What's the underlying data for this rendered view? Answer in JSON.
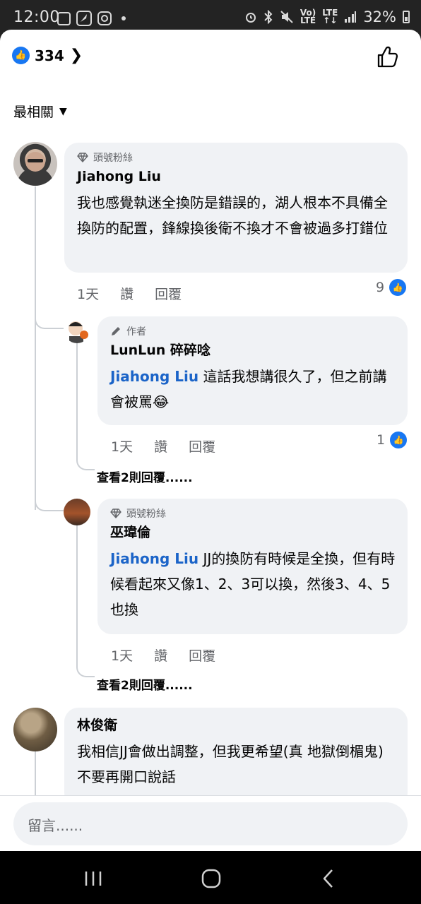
{
  "status_bar": {
    "time": "12:00",
    "battery": "32%",
    "lte_top": "Vo)\nLTE",
    "lte_bottom": "LTE\n↑↓"
  },
  "header": {
    "like_count": "334"
  },
  "sort": {
    "label": "最相關"
  },
  "comments": [
    {
      "badge": "頭號粉絲",
      "author": "Jiahong Liu",
      "text": "我也感覺執迷全換防是錯誤的，湖人根本不具備全換防的配置，鋒線換後衛不換才不會被過多打錯位",
      "time": "1天",
      "like": "讚",
      "reply": "回覆",
      "reactions": "9",
      "replies": [
        {
          "badge": "作者",
          "author": "LunLun 碎碎唸",
          "mention": "Jiahong Liu",
          "text": " 這話我想講很久了，但之前講會被罵",
          "emoji": "😂",
          "time": "1天",
          "like": "讚",
          "reply": "回覆",
          "reactions": "1",
          "view_more": "查看2則回覆......"
        },
        {
          "badge": "頭號粉絲",
          "author": "巫瑋倫",
          "mention": "Jiahong Liu",
          "text": " JJ的換防有時候是全換，但有時候看起來又像1、2、3可以換，然後3、4、5也換",
          "time": "1天",
          "like": "讚",
          "reply": "回覆",
          "view_more": "查看2則回覆......"
        }
      ]
    },
    {
      "author": "林俊衛",
      "text": "我相信JJ會做出調整，但我更希望(真 地獄倒楣鬼)不要再開口說話"
    }
  ],
  "composer": {
    "placeholder": "留言......"
  },
  "colors": {
    "accent": "#1877f2",
    "mention": "#1b64c8",
    "bubble": "#f0f2f5"
  }
}
